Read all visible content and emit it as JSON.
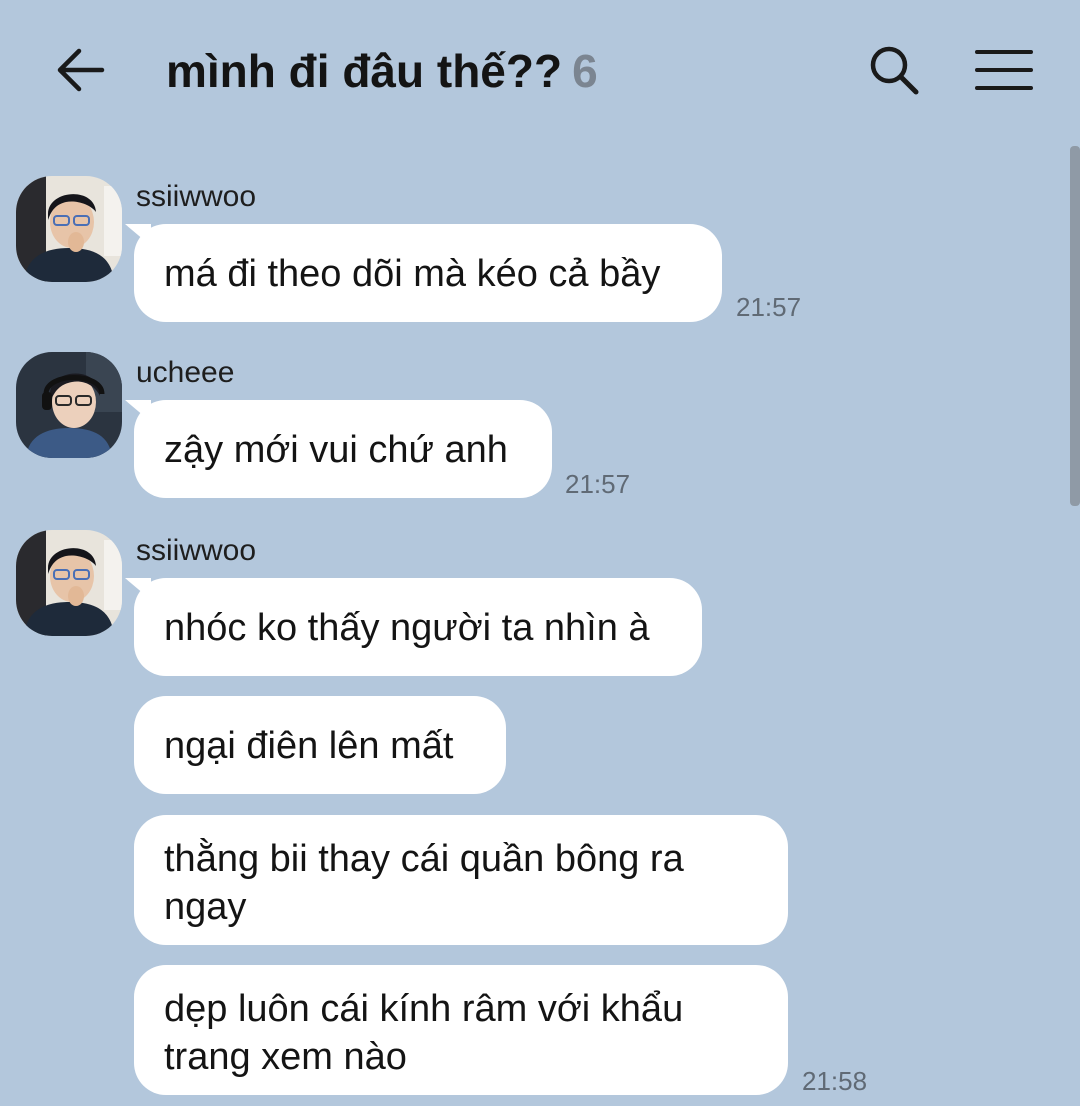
{
  "header": {
    "title": "mình đi đâu thế??",
    "member_count": "6",
    "back_icon": "back-arrow-icon",
    "search_icon": "search-icon",
    "menu_icon": "hamburger-menu-icon"
  },
  "colors": {
    "background": "#b3c7dc",
    "bubble": "#ffffff",
    "title": "#141414",
    "muted": "#7b8591"
  },
  "messages": [
    {
      "sender": "ssiiwwoo",
      "avatar_icon": "avatar-ssiiwwoo",
      "bubbles": [
        "má đi theo dõi mà kéo cả bầy"
      ],
      "time": "21:57"
    },
    {
      "sender": "ucheee",
      "avatar_icon": "avatar-ucheee",
      "bubbles": [
        "zậy mới vui chứ anh"
      ],
      "time": "21:57"
    },
    {
      "sender": "ssiiwwoo",
      "avatar_icon": "avatar-ssiiwwoo",
      "bubbles": [
        "nhóc ko thấy người ta nhìn à",
        "ngại điên lên mất",
        "thằng bii thay cái quần bông ra ngay",
        "dẹp luôn cái kính râm với khẩu trang xem nào"
      ],
      "time": "21:58"
    }
  ]
}
